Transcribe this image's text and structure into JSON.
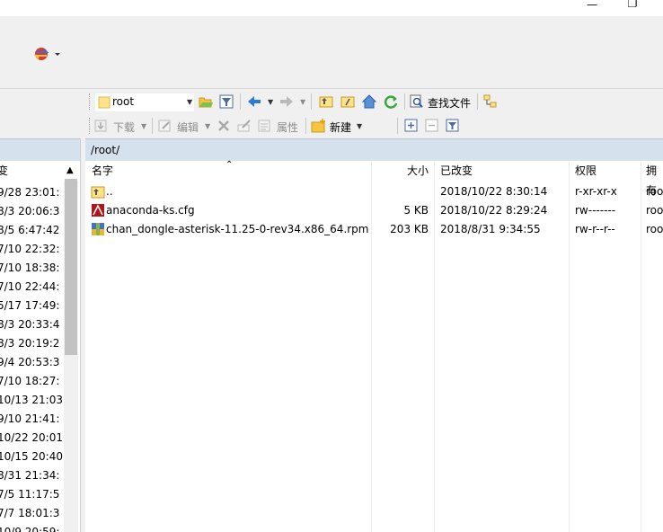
{
  "window": {
    "minimize_glyph": "—",
    "restore_glyph": "❐"
  },
  "toolbar_top": {
    "path_combo_value": "root",
    "find_files_label": "查找文件"
  },
  "toolbar_bottom": {
    "download_label": "下载",
    "edit_label": "编辑",
    "properties_label": "属性",
    "new_label": "新建"
  },
  "remote": {
    "path": "/root/",
    "columns": {
      "name": "名字",
      "size": "大小",
      "modified": "已改变",
      "permissions": "权限",
      "owner": "拥有"
    },
    "files": [
      {
        "name": "..",
        "size": "",
        "modified": "2018/10/22 8:30:14",
        "permissions": "r-xr-xr-x",
        "owner": "roo",
        "icon": "parent-folder-icon"
      },
      {
        "name": "anaconda-ks.cfg",
        "size": "5 KB",
        "modified": "2018/10/22 8:29:24",
        "permissions": "rw-------",
        "owner": "roo",
        "icon": "cfg-file-icon"
      },
      {
        "name": "chan_dongle-asterisk-11.25-0-rev34.x86_64.rpm",
        "size": "203 KB",
        "modified": "2018/8/31 9:34:55",
        "permissions": "rw-r--r--",
        "owner": "roo",
        "icon": "rpm-file-icon"
      }
    ]
  },
  "local": {
    "column_header": "变",
    "rows": [
      "9/28  23:01:",
      "8/3  20:06:3",
      "8/5  6:47:42",
      "7/10  22:32:",
      "7/10  18:38:",
      "7/10  22:44:",
      "5/17  17:49:",
      "8/3  20:33:4",
      "8/3  20:19:2",
      "9/4  20:53:3",
      "7/10  18:27:",
      "10/13  21:03",
      "9/10  21:41:",
      "10/22  20:01",
      "10/15  20:40",
      "8/31  21:34:",
      "7/5  11:17:5",
      "7/7  18:01:3",
      "10/9  20:59:"
    ]
  },
  "colors": {
    "pathbar": "#d6e1ee",
    "toolbar": "#f0f0f0"
  }
}
